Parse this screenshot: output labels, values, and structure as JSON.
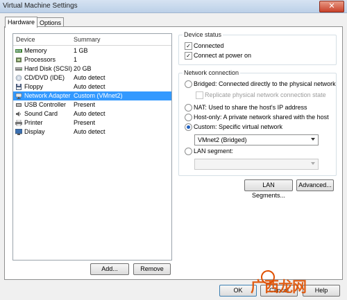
{
  "window": {
    "title": "Virtual Machine Settings",
    "close_symbol": "✕"
  },
  "tabs": [
    {
      "label": "Hardware"
    },
    {
      "label": "Options"
    }
  ],
  "device_list": {
    "columns": {
      "device": "Device",
      "summary": "Summary"
    },
    "rows": [
      {
        "device": "Memory",
        "summary": "1 GB",
        "icon": "memory-icon"
      },
      {
        "device": "Processors",
        "summary": "1",
        "icon": "processor-icon"
      },
      {
        "device": "Hard Disk (SCSI)",
        "summary": "20 GB",
        "icon": "hard-disk-icon"
      },
      {
        "device": "CD/DVD (IDE)",
        "summary": "Auto detect",
        "icon": "cd-dvd-icon"
      },
      {
        "device": "Floppy",
        "summary": "Auto detect",
        "icon": "floppy-icon"
      },
      {
        "device": "Network Adapter",
        "summary": "Custom (VMnet2)",
        "icon": "network-adapter-icon"
      },
      {
        "device": "USB Controller",
        "summary": "Present",
        "icon": "usb-icon"
      },
      {
        "device": "Sound Card",
        "summary": "Auto detect",
        "icon": "sound-card-icon"
      },
      {
        "device": "Printer",
        "summary": "Present",
        "icon": "printer-icon"
      },
      {
        "device": "Display",
        "summary": "Auto detect",
        "icon": "display-icon"
      }
    ],
    "selected_index": 5
  },
  "list_buttons": {
    "add": "Add...",
    "remove": "Remove"
  },
  "device_status": {
    "title": "Device status",
    "connected": {
      "label": "Connected",
      "checked": true
    },
    "connect_at_power_on": {
      "label": "Connect at power on",
      "checked": true
    }
  },
  "network_connection": {
    "title": "Network connection",
    "bridged": "Bridged: Connected directly to the physical network",
    "replicate": "Replicate physical network connection state",
    "nat": "NAT: Used to share the host's IP address",
    "host_only": "Host-only: A private network shared with the host",
    "custom": "Custom: Specific virtual network",
    "custom_value": "VMnet2 (Bridged)",
    "lan_segment": "LAN segment:",
    "selected": "custom"
  },
  "network_buttons": {
    "lan_segments": "LAN Segments...",
    "advanced": "Advanced..."
  },
  "footer_buttons": {
    "ok": "OK",
    "cancel": "Cancel",
    "help": "Help"
  },
  "watermark": {
    "text": "广西龙网"
  }
}
